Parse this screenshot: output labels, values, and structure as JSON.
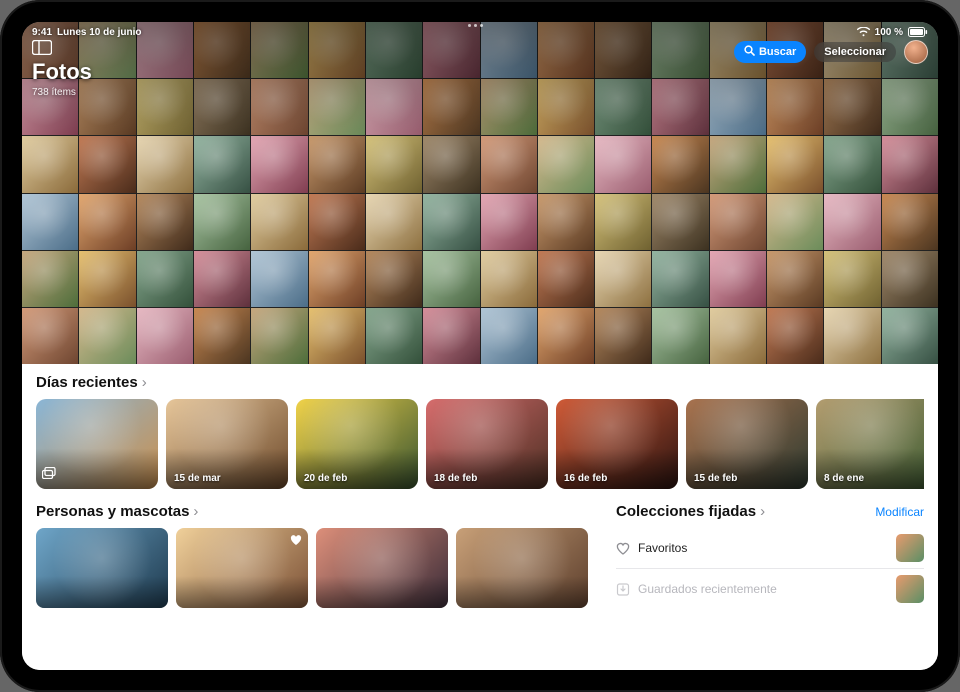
{
  "statusbar": {
    "time": "9:41",
    "date": "Lunes 10 de junio",
    "battery_text": "100 %"
  },
  "header": {
    "app_title": "Fotos",
    "item_count": "738 ítems",
    "search_label": "Buscar",
    "select_label": "Seleccionar"
  },
  "sections": {
    "recent_days": {
      "title": "Días recientes",
      "cards": [
        {
          "label": "",
          "a": "#8ab6d6",
          "b": "#c9904f",
          "icon": "stack"
        },
        {
          "label": "15 de mar",
          "a": "#e6c69a",
          "b": "#6e4a2b"
        },
        {
          "label": "20 de feb",
          "a": "#f0d24a",
          "b": "#3a5530"
        },
        {
          "label": "18 de feb",
          "a": "#d66d6d",
          "b": "#4e2f23"
        },
        {
          "label": "16 de feb",
          "a": "#cf5b38",
          "b": "#2d1410"
        },
        {
          "label": "15 de feb",
          "a": "#a9734f",
          "b": "#2d3a30"
        },
        {
          "label": "8 de ene",
          "a": "#b39d70",
          "b": "#3d5c32"
        }
      ]
    },
    "people_pets": {
      "title": "Personas y mascotas",
      "cards": [
        {
          "a": "#6fa6c9",
          "b": "#1e3a4e"
        },
        {
          "a": "#f0d09a",
          "b": "#7c5136",
          "fav": true
        },
        {
          "a": "#dd8f7a",
          "b": "#3b2c38"
        },
        {
          "a": "#c8a078",
          "b": "#5d3f2d"
        }
      ]
    },
    "pinned": {
      "title": "Colecciones fijadas",
      "edit_label": "Modificar",
      "rows": [
        {
          "label": "Favoritos",
          "icon": "heart"
        },
        {
          "label": "Guardados recientemente",
          "icon": "download"
        }
      ]
    }
  },
  "grid_palette": [
    [
      "#d49b7a",
      "#6e4530"
    ],
    [
      "#d5b98e",
      "#6b8c5a"
    ],
    [
      "#e7b9c3",
      "#9a5d6f"
    ],
    [
      "#c98952",
      "#4b3520"
    ],
    [
      "#c7a880",
      "#4d6d3a"
    ],
    [
      "#e6c170",
      "#7a502c"
    ],
    [
      "#86a78e",
      "#33503a"
    ],
    [
      "#d68f9b",
      "#5e303c"
    ],
    [
      "#b1c6d6",
      "#4b6d88"
    ],
    [
      "#e2a76f",
      "#6d3e25"
    ],
    [
      "#b5895e",
      "#3f2a1a"
    ],
    [
      "#a8c4a2",
      "#46633f"
    ],
    [
      "#e1cda0",
      "#8a6a3a"
    ],
    [
      "#c27b55",
      "#4a2b1a"
    ],
    [
      "#e7d6b2",
      "#8d7040"
    ],
    [
      "#94b5a1",
      "#365043"
    ],
    [
      "#e4a7b4",
      "#803d50"
    ],
    [
      "#c99a6d",
      "#5a3a22"
    ],
    [
      "#d5c27a",
      "#6f6130"
    ],
    [
      "#a0896b",
      "#3c3120"
    ]
  ]
}
